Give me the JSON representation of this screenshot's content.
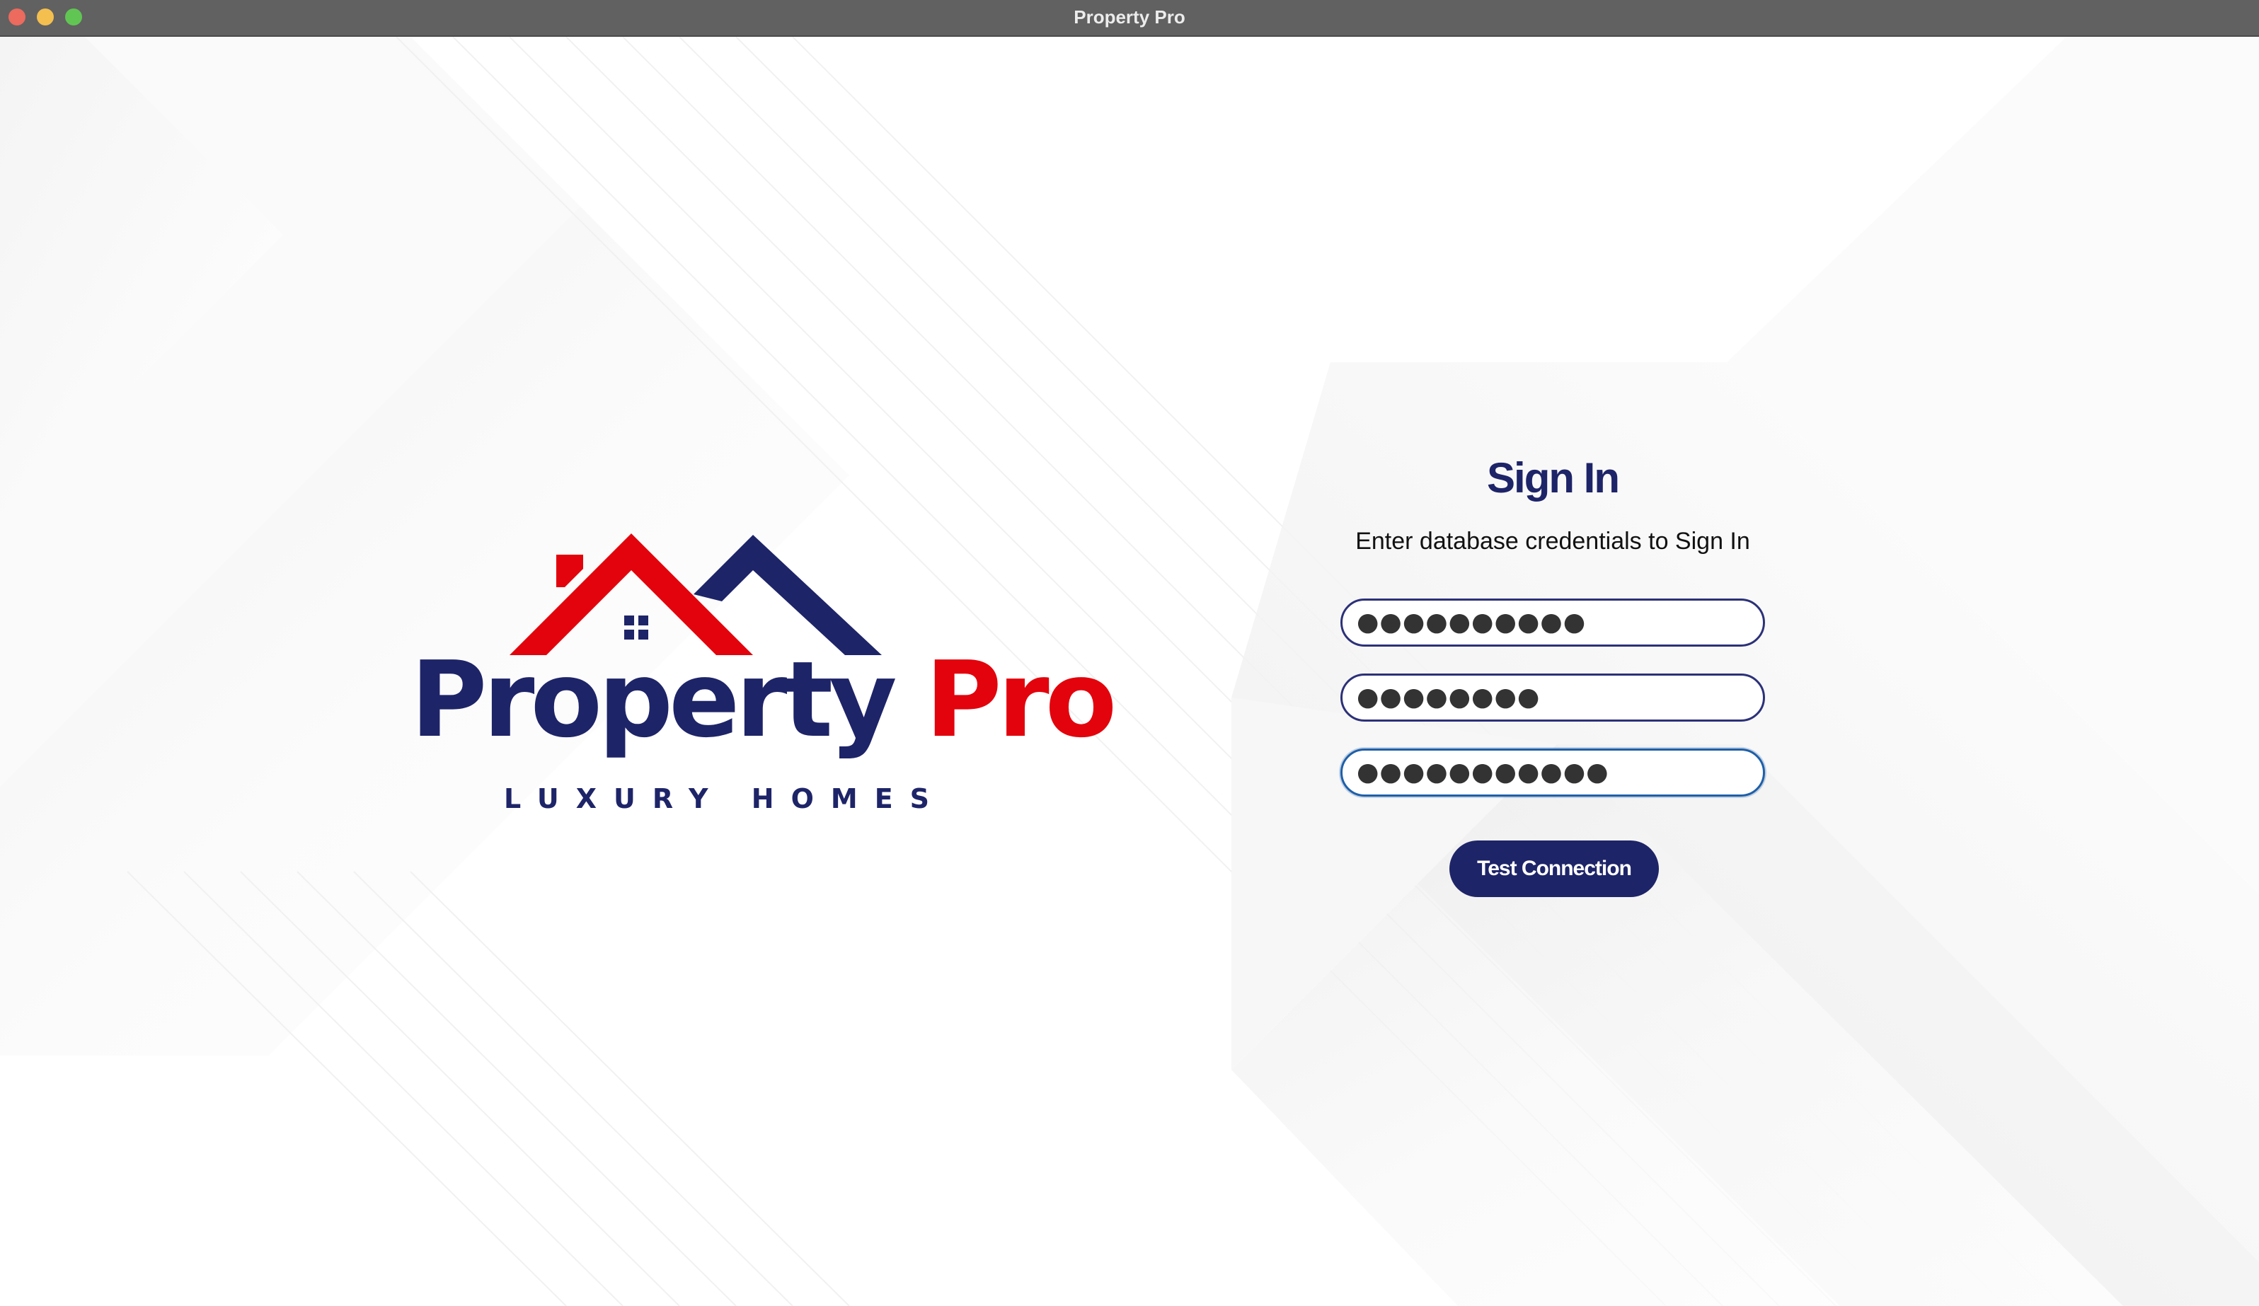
{
  "window": {
    "title": "Property Pro"
  },
  "logo": {
    "word_primary": "Property",
    "word_accent": "Pro",
    "tagline": "LUXURY HOMES",
    "colors": {
      "navy": "#1e2468",
      "red": "#e3030c"
    }
  },
  "signin": {
    "title": "Sign In",
    "subtitle": "Enter database credentials to Sign In",
    "fields": [
      {
        "value": "●●●●●●●●●●",
        "type": "password"
      },
      {
        "value": "●●●●●●●●",
        "type": "password"
      },
      {
        "value": "●●●●●●●●●●●",
        "type": "password",
        "focused": true
      }
    ],
    "button_label": "Test Connection"
  },
  "theme": {
    "accent": "#1e2468",
    "titlebar": "#616161",
    "background": "#ffffff"
  }
}
